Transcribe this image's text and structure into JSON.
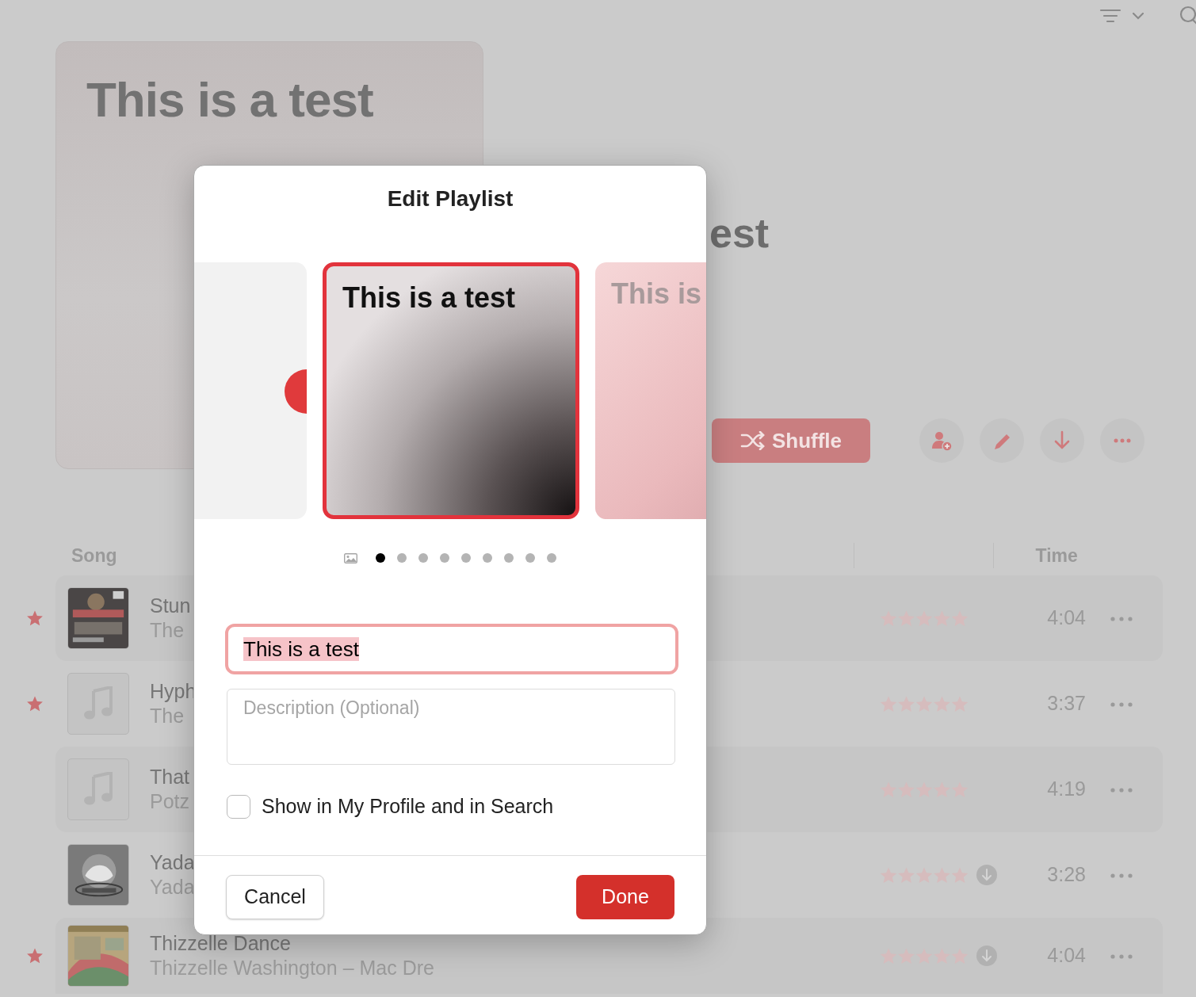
{
  "playlist": {
    "artwork_title": "This is a test",
    "title": "est",
    "shuffle_label": "Shuffle"
  },
  "table": {
    "columns": [
      "Song",
      "Time"
    ],
    "rows": [
      {
        "kind": "picture",
        "favorite": true,
        "title": "Stun",
        "subtitle": "The",
        "downloaded": false,
        "time": "4:04"
      },
      {
        "kind": "placeholder",
        "favorite": true,
        "title": "Hyph",
        "subtitle": "The",
        "downloaded": false,
        "time": "3:37"
      },
      {
        "kind": "placeholder",
        "favorite": false,
        "title": "That",
        "subtitle": "Potz",
        "downloaded": false,
        "time": "4:19"
      },
      {
        "kind": "picture",
        "favorite": false,
        "title": "Yada",
        "subtitle": "Yada",
        "downloaded": true,
        "time": "3:28"
      },
      {
        "kind": "picture",
        "favorite": true,
        "title": "Thizzelle Dance",
        "subtitle": "Thizzelle Washington – Mac Dre",
        "downloaded": true,
        "time": "4:04"
      }
    ]
  },
  "dialog": {
    "title": "Edit Playlist",
    "cards": [
      {
        "kind": "plain",
        "selected": false
      },
      {
        "kind": "gradient",
        "title": "This is a test",
        "selected": true
      },
      {
        "kind": "pink",
        "title": "This is",
        "selected": false
      }
    ],
    "pager": [
      {
        "kind": "dot",
        "selected": true
      },
      {
        "kind": "dot",
        "selected": false
      },
      {
        "kind": "dot",
        "selected": false
      },
      {
        "kind": "dot",
        "selected": false
      },
      {
        "kind": "dot",
        "selected": false
      },
      {
        "kind": "dot",
        "selected": false
      },
      {
        "kind": "dot",
        "selected": false
      },
      {
        "kind": "dot",
        "selected": false
      },
      {
        "kind": "dot",
        "selected": false
      }
    ],
    "name_value": "This is a test",
    "name_text_selected": true,
    "description_placeholder": "Description (Optional)",
    "profile_option": {
      "label": "Show in My Profile and in Search",
      "checked": false
    },
    "buttons": [
      {
        "label": "Cancel",
        "kind": "secondary"
      },
      {
        "label": "Done",
        "kind": "primary"
      }
    ]
  }
}
